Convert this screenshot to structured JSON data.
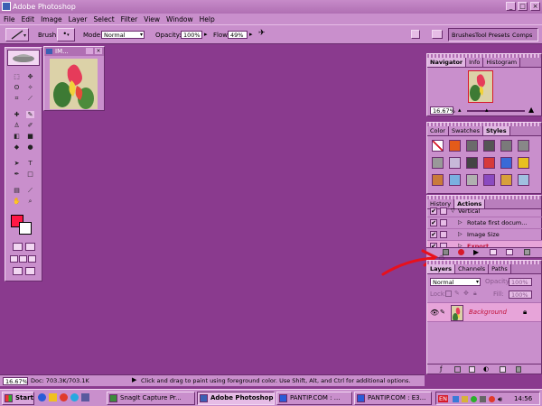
{
  "window": {
    "title": "Adobe Photoshop",
    "controls": [
      "_",
      "□",
      "×"
    ]
  },
  "menu": [
    "File",
    "Edit",
    "Image",
    "Layer",
    "Select",
    "Filter",
    "View",
    "Window",
    "Help"
  ],
  "options": {
    "brush_label": "Brush:",
    "mode_label": "Mode:",
    "mode_value": "Normal",
    "opacity_label": "Opacity:",
    "opacity_value": "100%",
    "flow_label": "Flow:",
    "flow_value": "49%",
    "well_tabs": [
      "Brushes",
      "Tool Presets",
      "Comps"
    ]
  },
  "document": {
    "title": "IM..."
  },
  "navigator": {
    "tabs": [
      "Navigator",
      "Info",
      "Histogram"
    ],
    "zoom": "16.67%"
  },
  "styles": {
    "tabs": [
      "Color",
      "Swatches",
      "Styles"
    ]
  },
  "actions": {
    "tabs": [
      "History",
      "Actions"
    ],
    "rows": [
      {
        "label": "Vertical",
        "level": 1
      },
      {
        "label": "Rotate first docum...",
        "level": 2
      },
      {
        "label": "Image Size",
        "level": 2
      },
      {
        "label": "Export",
        "level": 2
      }
    ]
  },
  "layers": {
    "tabs": [
      "Layers",
      "Channels",
      "Paths"
    ],
    "blend_mode": "Normal",
    "opacity_label": "Opacity:",
    "opacity_value": "100%",
    "lock_label": "Lock:",
    "fill_label": "Fill:",
    "fill_value": "100%",
    "layer_name": "Background"
  },
  "status": {
    "zoom": "16.67%",
    "doc": "Doc: 703.3K/703.1K",
    "hint": "Click and drag to paint using foreground color.  Use Shift, Alt, and Ctrl for additional options."
  },
  "taskbar": {
    "start": "Start",
    "tasks": [
      "SnagIt Capture Pr...",
      "Adobe Photoshop",
      "PANTIP.COM : ...",
      "PANTIP.COM : E3..."
    ],
    "tray_lang": "EN",
    "clock": "14:56"
  },
  "colors": {
    "workspace": "#8a3a8e",
    "panel": "#c98fcc",
    "foreground": "#ff1744",
    "annotation_arrow": "#e8101c"
  }
}
